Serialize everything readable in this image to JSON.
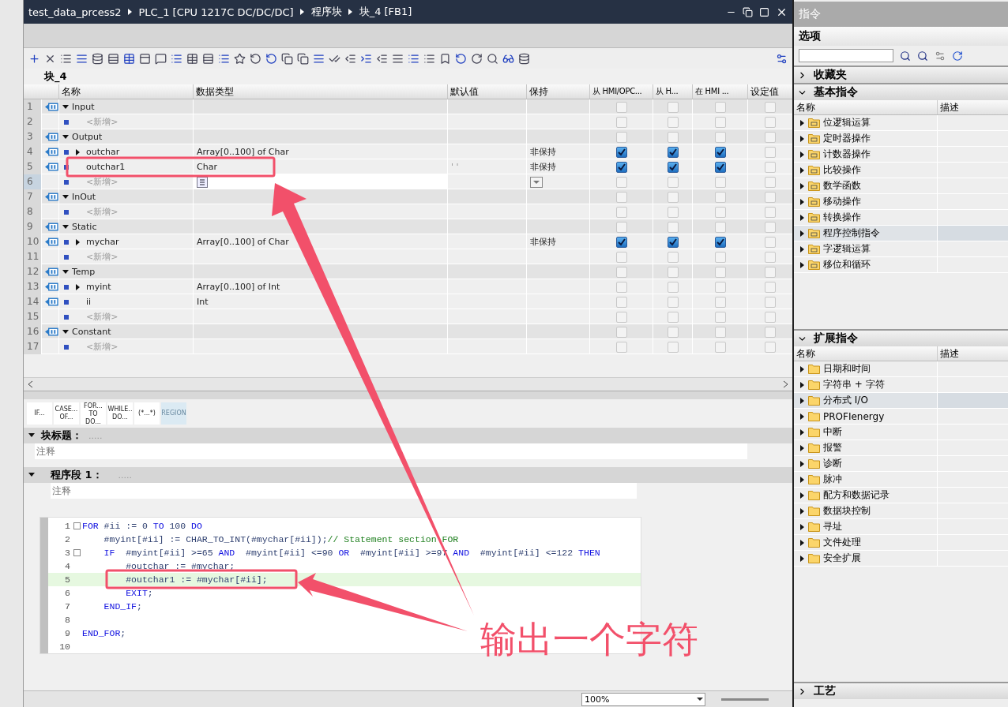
{
  "breadcrumb": [
    "test_data_prcess2",
    "PLC_1 [CPU 1217C DC/DC/DC]",
    "程序块",
    "块_4 [FB1]"
  ],
  "block_name": "块_4",
  "interface": {
    "columns": [
      "名称",
      "数据类型",
      "默认值",
      "保持",
      "从 HMI/OPC...",
      "从 H...",
      "在 HMI ...",
      "设定值"
    ],
    "rows": [
      {
        "num": "1",
        "kind": "section",
        "name": "Input",
        "expanded": true,
        "checks": [
          false,
          false,
          false,
          false
        ]
      },
      {
        "num": "2",
        "kind": "add",
        "name": "<新增>",
        "checks": [
          false,
          false,
          false,
          false
        ]
      },
      {
        "num": "3",
        "kind": "section",
        "name": "Output",
        "expanded": true,
        "checks": [
          false,
          false,
          false,
          false
        ]
      },
      {
        "num": "4",
        "kind": "var",
        "name": "outchar",
        "expanded": false,
        "type": "Array[0..100] of Char",
        "retain": "非保持",
        "checks": [
          true,
          true,
          true,
          false
        ]
      },
      {
        "num": "5",
        "kind": "var",
        "name": "outchar1",
        "type": "Char",
        "default": "' '",
        "retain": "非保持",
        "checks": [
          true,
          true,
          true,
          false
        ]
      },
      {
        "num": "6",
        "kind": "add",
        "name": "<新增>",
        "editing": true,
        "checks": [
          false,
          false,
          false,
          false
        ]
      },
      {
        "num": "7",
        "kind": "section",
        "name": "InOut",
        "expanded": true,
        "checks": [
          false,
          false,
          false,
          false
        ]
      },
      {
        "num": "8",
        "kind": "add",
        "name": "<新增>",
        "checks": [
          false,
          false,
          false,
          false
        ]
      },
      {
        "num": "9",
        "kind": "section",
        "name": "Static",
        "expanded": true,
        "checks": [
          false,
          false,
          false,
          false
        ]
      },
      {
        "num": "10",
        "kind": "var",
        "name": "mychar",
        "expanded": false,
        "type": "Array[0..100] of Char",
        "retain": "非保持",
        "checks": [
          true,
          true,
          true,
          false
        ]
      },
      {
        "num": "11",
        "kind": "add",
        "name": "<新增>",
        "checks": [
          false,
          false,
          false,
          false
        ]
      },
      {
        "num": "12",
        "kind": "section",
        "name": "Temp",
        "expanded": true,
        "checks": [
          false,
          false,
          false,
          false
        ]
      },
      {
        "num": "13",
        "kind": "var",
        "name": "myint",
        "expanded": false,
        "type": "Array[0..100] of Int",
        "checks": [
          false,
          false,
          false,
          false
        ]
      },
      {
        "num": "14",
        "kind": "var",
        "name": "ii",
        "type": "Int",
        "checks": [
          false,
          false,
          false,
          false
        ]
      },
      {
        "num": "15",
        "kind": "add",
        "name": "<新增>",
        "checks": [
          false,
          false,
          false,
          false
        ]
      },
      {
        "num": "16",
        "kind": "section",
        "name": "Constant",
        "expanded": true,
        "checks": [
          false,
          false,
          false,
          false
        ]
      },
      {
        "num": "17",
        "kind": "add",
        "name": "<新增>",
        "checks": [
          false,
          false,
          false,
          false
        ]
      }
    ]
  },
  "snippets": [
    "IF...",
    "CASE...\nOF...",
    "FOR...\nTO DO...",
    "WHILE..\nDO...",
    "(*...*)",
    "REGION"
  ],
  "block_title": {
    "label": "块标题：",
    "value": ".....",
    "expanded": true,
    "comment": "注释"
  },
  "network": {
    "label": "程序段 1：",
    "value": ".....",
    "expanded": true,
    "comment": "注释"
  },
  "code": [
    {
      "num": "1",
      "fold": true,
      "tokens": [
        {
          "kind": "kw",
          "text": "FOR"
        },
        {
          "kind": "id",
          "text": " #ii := 0 "
        },
        {
          "kind": "kw",
          "text": "TO"
        },
        {
          "kind": "id",
          "text": " 100 "
        },
        {
          "kind": "kw",
          "text": "DO"
        }
      ]
    },
    {
      "num": "2",
      "tokens": [
        {
          "kind": "id",
          "text": "    #myint[#ii] := CHAR_TO_INT(#mychar[#ii]);"
        },
        {
          "kind": "cm",
          "text": "// Statement section FOR"
        }
      ]
    },
    {
      "num": "3",
      "fold": true,
      "tokens": [
        {
          "kind": "kw",
          "text": "    IF"
        },
        {
          "kind": "id",
          "text": "  #myint[#ii] >=65 "
        },
        {
          "kind": "kw",
          "text": "AND"
        },
        {
          "kind": "id",
          "text": "  #myint[#ii] <=90 "
        },
        {
          "kind": "kw",
          "text": "OR"
        },
        {
          "kind": "id",
          "text": "  #myint[#ii] >=97 "
        },
        {
          "kind": "kw",
          "text": "AND"
        },
        {
          "kind": "id",
          "text": "  #myint[#ii] <=122 "
        },
        {
          "kind": "kw",
          "text": "THEN"
        }
      ]
    },
    {
      "num": "4",
      "tokens": [
        {
          "kind": "id",
          "text": "        #outchar := #mychar;"
        }
      ]
    },
    {
      "num": "5",
      "current": true,
      "tokens": [
        {
          "kind": "id",
          "text": "        #outchar1 := #mychar[#ii];"
        }
      ]
    },
    {
      "num": "6",
      "tokens": [
        {
          "kind": "kw",
          "text": "        EXIT"
        },
        {
          "kind": "id",
          "text": ";"
        }
      ]
    },
    {
      "num": "7",
      "tokens": [
        {
          "kind": "kw",
          "text": "    END_IF"
        },
        {
          "kind": "id",
          "text": ";"
        }
      ]
    },
    {
      "num": "8"
    },
    {
      "num": "9",
      "tokens": [
        {
          "kind": "kw",
          "text": "END_FOR"
        },
        {
          "kind": "id",
          "text": ";"
        }
      ]
    },
    {
      "num": "10"
    }
  ],
  "zoom": "100%",
  "instructions": {
    "title": "指令",
    "options": "选项",
    "sections": [
      {
        "title": "收藏夹",
        "expanded": false
      },
      {
        "title": "基本指令",
        "expanded": true,
        "columns": [
          "名称",
          "描述"
        ],
        "items": [
          {
            "label": "位逻辑运算",
            "selected": false
          },
          {
            "label": "定时器操作",
            "selected": false
          },
          {
            "label": "计数器操作",
            "selected": false
          },
          {
            "label": "比较操作",
            "selected": false
          },
          {
            "label": "数学函数",
            "selected": false
          },
          {
            "label": "移动操作",
            "selected": false
          },
          {
            "label": "转换操作",
            "selected": false
          },
          {
            "label": "程序控制指令",
            "selected": true
          },
          {
            "label": "字逻辑运算",
            "selected": false
          },
          {
            "label": "移位和循环",
            "selected": false
          }
        ]
      },
      {
        "title": "扩展指令",
        "expanded": true,
        "columns": [
          "名称",
          "描述"
        ],
        "items": [
          {
            "label": "日期和时间",
            "selected": false
          },
          {
            "label": "字符串 + 字符",
            "selected": false
          },
          {
            "label": "分布式 I/O",
            "selected": true
          },
          {
            "label": "PROFIenergy",
            "selected": false
          },
          {
            "label": "中断",
            "selected": false
          },
          {
            "label": "报警",
            "selected": false
          },
          {
            "label": "诊断",
            "selected": false
          },
          {
            "label": "脉冲",
            "selected": false
          },
          {
            "label": "配方和数据记录",
            "selected": false
          },
          {
            "label": "数据块控制",
            "selected": false
          },
          {
            "label": "寻址",
            "selected": false
          },
          {
            "label": "文件处理",
            "selected": false
          },
          {
            "label": "安全扩展",
            "selected": false
          }
        ]
      },
      {
        "title": "工艺",
        "expanded": false
      }
    ]
  },
  "annotation": {
    "text": "输出一个字符"
  }
}
